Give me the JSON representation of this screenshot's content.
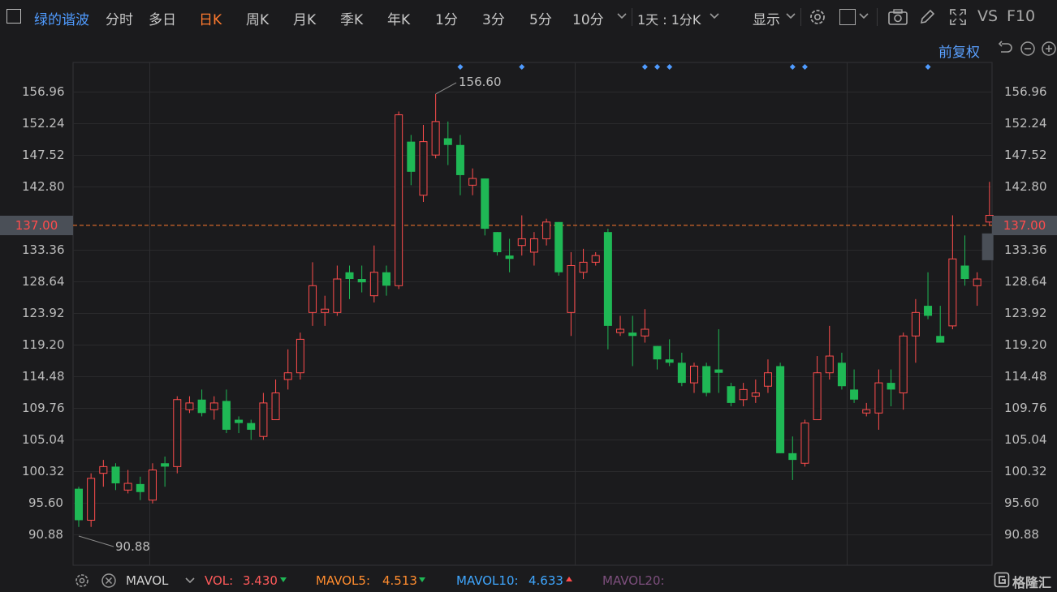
{
  "toolbar": {
    "stock_name": "绿的谐波",
    "periods": [
      "分时",
      "多日",
      "日K",
      "周K",
      "月K",
      "季K",
      "年K",
      "1分",
      "3分",
      "5分",
      "10分"
    ],
    "active_period": "日K",
    "combo": "1天 : 1分K",
    "display": "显示",
    "vs": "VS",
    "f10": "F10"
  },
  "chart_header": {
    "adjust": "前复权"
  },
  "y_ticks": [
    "156.96",
    "152.24",
    "147.52",
    "142.80",
    "137.00",
    "133.36",
    "128.64",
    "123.92",
    "119.20",
    "114.48",
    "109.76",
    "105.04",
    "100.32",
    "95.60",
    "90.88"
  ],
  "current_price": "137.00",
  "annotations": {
    "high": "156.60",
    "low": "90.88"
  },
  "indicator": {
    "name": "MAVOL",
    "vol_label": "VOL:",
    "vol_value": "3.430",
    "mavol5_label": "MAVOL5:",
    "mavol5_value": "4.513",
    "mavol10_label": "MAVOL10:",
    "mavol10_value": "4.633",
    "mavol20_label": "MAVOL20:"
  },
  "watermark": "格隆汇",
  "colors": {
    "up": "#ff4d4d",
    "down": "#1fb855",
    "accent": "#ff7a2e",
    "link": "#4f9bff",
    "background": "#1b1b1d"
  },
  "chart_data": {
    "type": "candlestick",
    "ylim": [
      86.16,
      161.68
    ],
    "markers_on_candles": [
      31,
      36,
      46,
      47,
      48,
      58,
      59,
      69
    ],
    "candles": [
      [
        97.7,
        93.0,
        98.0,
        92.0
      ],
      [
        93.0,
        99.25,
        100.0,
        92.0
      ],
      [
        100.0,
        101.0,
        102.0,
        98.0
      ],
      [
        101.0,
        98.5,
        101.5,
        97.5
      ],
      [
        97.5,
        98.5,
        100.5,
        97.0
      ],
      [
        98.4,
        97.2,
        99.5,
        96.0
      ],
      [
        96.0,
        100.5,
        101.5,
        95.5
      ],
      [
        101.5,
        101.0,
        102.5,
        98.0
      ],
      [
        101.0,
        111.0,
        111.5,
        100.0
      ],
      [
        109.5,
        110.5,
        111.5,
        109.0
      ],
      [
        111.0,
        109.0,
        112.5,
        108.5
      ],
      [
        109.5,
        110.5,
        111.5,
        108.0
      ],
      [
        110.8,
        106.5,
        112.5,
        106.0
      ],
      [
        108.0,
        107.5,
        108.5,
        106.0
      ],
      [
        107.5,
        106.5,
        108.0,
        105.0
      ],
      [
        105.5,
        110.5,
        112.0,
        105.0
      ],
      [
        108.0,
        112.0,
        114.0,
        108.0
      ],
      [
        114.0,
        115.0,
        118.5,
        112.5
      ],
      [
        115.0,
        120.0,
        121.0,
        114.0
      ],
      [
        124.0,
        128.0,
        131.5,
        122.0
      ],
      [
        124.0,
        124.5,
        126.5,
        122.0
      ],
      [
        124.0,
        129.0,
        131.0,
        123.5
      ],
      [
        130.0,
        129.0,
        131.0,
        126.0
      ],
      [
        129.0,
        128.5,
        131.0,
        127.0
      ],
      [
        126.5,
        130.0,
        134.0,
        125.5
      ],
      [
        130.0,
        128.0,
        131.0,
        126.5
      ],
      [
        128.0,
        153.5,
        154.0,
        127.5
      ],
      [
        149.5,
        145.0,
        150.5,
        143.0
      ],
      [
        141.5,
        149.5,
        152.0,
        140.5
      ],
      [
        147.5,
        152.5,
        156.6,
        147.0
      ],
      [
        150.0,
        149.0,
        152.5,
        146.0
      ],
      [
        149.0,
        144.5,
        150.5,
        141.5
      ],
      [
        143.0,
        144.0,
        145.5,
        141.5
      ],
      [
        144.0,
        136.5,
        144.0,
        135.5
      ],
      [
        136.0,
        133.0,
        136.0,
        132.5
      ],
      [
        132.5,
        132.0,
        135.0,
        130.0
      ],
      [
        134.0,
        135.0,
        138.5,
        132.5
      ],
      [
        133.0,
        135.0,
        136.0,
        131.0
      ],
      [
        135.0,
        137.5,
        138.0,
        134.0
      ],
      [
        137.5,
        130.0,
        137.5,
        129.5
      ],
      [
        124.0,
        131.0,
        133.0,
        120.5
      ],
      [
        130.0,
        131.5,
        133.5,
        129.0
      ],
      [
        131.5,
        132.5,
        133.0,
        131.0
      ],
      [
        136.0,
        122.0,
        136.5,
        118.5
      ],
      [
        121.0,
        121.5,
        123.5,
        120.5
      ],
      [
        121.0,
        120.5,
        123.5,
        116.0
      ],
      [
        120.5,
        121.5,
        124.5,
        119.5
      ],
      [
        119.0,
        117.0,
        119.0,
        115.5
      ],
      [
        117.0,
        116.5,
        120.0,
        116.0
      ],
      [
        116.5,
        113.5,
        118.0,
        113.0
      ],
      [
        113.5,
        116.0,
        116.5,
        112.0
      ],
      [
        116.0,
        112.0,
        116.5,
        111.5
      ],
      [
        115.5,
        115.0,
        121.5,
        112.0
      ],
      [
        113.0,
        110.5,
        113.5,
        110.0
      ],
      [
        111.0,
        112.5,
        113.5,
        110.0
      ],
      [
        111.5,
        112.0,
        114.0,
        110.5
      ],
      [
        113.0,
        115.0,
        117.0,
        112.0
      ],
      [
        116.0,
        103.0,
        116.5,
        103.0
      ],
      [
        103.0,
        102.0,
        105.5,
        99.0
      ],
      [
        101.5,
        107.5,
        108.0,
        101.0
      ],
      [
        108.0,
        115.0,
        117.5,
        108.0
      ],
      [
        115.0,
        117.5,
        122.0,
        114.0
      ],
      [
        116.5,
        113.0,
        118.0,
        112.5
      ],
      [
        112.5,
        111.0,
        115.5,
        110.5
      ],
      [
        109.0,
        109.5,
        110.5,
        108.5
      ],
      [
        109.0,
        113.5,
        115.5,
        106.5
      ],
      [
        113.5,
        112.5,
        115.5,
        110.0
      ],
      [
        112.0,
        120.5,
        121.0,
        109.5
      ],
      [
        120.5,
        124.0,
        126.0,
        116.5
      ],
      [
        125.0,
        123.5,
        130.0,
        123.0
      ],
      [
        120.5,
        119.5,
        125.0,
        119.5
      ],
      [
        122.0,
        132.0,
        138.5,
        121.5
      ],
      [
        131.0,
        129.0,
        135.5,
        128.0
      ],
      [
        128.0,
        129.0,
        130.0,
        125.0
      ],
      [
        137.5,
        138.5,
        143.5,
        137.0
      ]
    ]
  }
}
